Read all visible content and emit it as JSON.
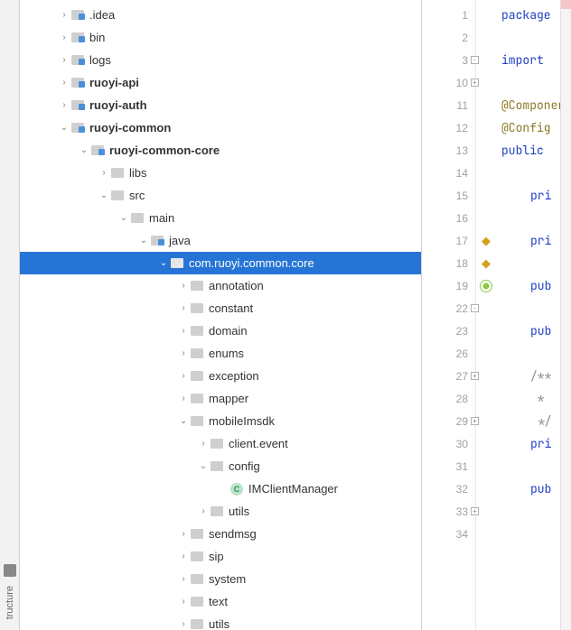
{
  "toolwindow": {
    "structure_label": "tructure"
  },
  "tree": [
    {
      "depth": 0,
      "expand": ">",
      "icon": "folder-marked",
      "label": ".idea"
    },
    {
      "depth": 0,
      "expand": ">",
      "icon": "folder-marked",
      "label": "bin"
    },
    {
      "depth": 0,
      "expand": ">",
      "icon": "folder-marked",
      "label": "logs"
    },
    {
      "depth": 0,
      "expand": ">",
      "icon": "folder-marked",
      "label": "ruoyi-api",
      "bold": true
    },
    {
      "depth": 0,
      "expand": ">",
      "icon": "folder-marked",
      "label": "ruoyi-auth",
      "bold": true
    },
    {
      "depth": 0,
      "expand": "v",
      "icon": "folder-marked",
      "label": "ruoyi-common",
      "bold": true
    },
    {
      "depth": 1,
      "expand": "v",
      "icon": "folder-marked",
      "label": "ruoyi-common-core",
      "bold": true
    },
    {
      "depth": 2,
      "expand": ">",
      "icon": "folder-plain",
      "label": "libs"
    },
    {
      "depth": 2,
      "expand": "v",
      "icon": "folder-plain",
      "label": "src"
    },
    {
      "depth": 3,
      "expand": "v",
      "icon": "folder-plain",
      "label": "main"
    },
    {
      "depth": 4,
      "expand": "v",
      "icon": "folder-marked",
      "label": "java"
    },
    {
      "depth": 5,
      "expand": "v",
      "icon": "folder-plain",
      "label": "com.ruoyi.common.core",
      "selected": true
    },
    {
      "depth": 6,
      "expand": ">",
      "icon": "folder-plain",
      "label": "annotation"
    },
    {
      "depth": 6,
      "expand": ">",
      "icon": "folder-plain",
      "label": "constant"
    },
    {
      "depth": 6,
      "expand": ">",
      "icon": "folder-plain",
      "label": "domain"
    },
    {
      "depth": 6,
      "expand": ">",
      "icon": "folder-plain",
      "label": "enums"
    },
    {
      "depth": 6,
      "expand": ">",
      "icon": "folder-plain",
      "label": "exception"
    },
    {
      "depth": 6,
      "expand": ">",
      "icon": "folder-plain",
      "label": "mapper"
    },
    {
      "depth": 6,
      "expand": "v",
      "icon": "folder-plain",
      "label": "mobileImsdk"
    },
    {
      "depth": 7,
      "expand": ">",
      "icon": "folder-plain",
      "label": "client.event"
    },
    {
      "depth": 7,
      "expand": "v",
      "icon": "folder-plain",
      "label": "config"
    },
    {
      "depth": 8,
      "expand": "",
      "icon": "class",
      "label": "IMClientManager"
    },
    {
      "depth": 7,
      "expand": ">",
      "icon": "folder-plain",
      "label": "utils"
    },
    {
      "depth": 6,
      "expand": ">",
      "icon": "folder-plain",
      "label": "sendmsg"
    },
    {
      "depth": 6,
      "expand": ">",
      "icon": "folder-plain",
      "label": "sip"
    },
    {
      "depth": 6,
      "expand": ">",
      "icon": "folder-plain",
      "label": "system"
    },
    {
      "depth": 6,
      "expand": ">",
      "icon": "folder-plain",
      "label": "text"
    },
    {
      "depth": 6,
      "expand": ">",
      "icon": "folder-plain",
      "label": "utils"
    }
  ],
  "gutter": {
    "lines": [
      "1",
      "2",
      "3",
      "10",
      "11",
      "12",
      "13",
      "14",
      "15",
      "16",
      "17",
      "18",
      "19",
      "22",
      "23",
      "26",
      "27",
      "28",
      "29",
      "30",
      "31",
      "32",
      "33",
      "34"
    ],
    "folds": {
      "2": "-",
      "3": "+",
      "13": "-",
      "16": "+",
      "18": "+",
      "22": "+",
      "26": "+",
      "31": "-"
    },
    "marks": {
      "10": "y",
      "11": "y",
      "12": "spring"
    }
  },
  "code": {
    "lines": [
      {
        "ln": "1",
        "cls": "",
        "html": "<span class='kw'>package</span>"
      },
      {
        "ln": "2",
        "cls": "",
        "html": ""
      },
      {
        "ln": "3",
        "cls": "",
        "html": "<span class='kw'>import</span> "
      },
      {
        "ln": "10",
        "cls": "",
        "html": ""
      },
      {
        "ln": "11",
        "cls": "",
        "html": "<span class='ann'>@Componer</span>"
      },
      {
        "ln": "12",
        "cls": "",
        "html": "<span class='ann'>@Config</span>"
      },
      {
        "ln": "13",
        "cls": "",
        "html": "<span class='kw'>public</span> "
      },
      {
        "ln": "14",
        "cls": "",
        "html": ""
      },
      {
        "ln": "15",
        "cls": "indent1",
        "html": "<span class='kw'>pri</span>"
      },
      {
        "ln": "16",
        "cls": "",
        "html": ""
      },
      {
        "ln": "17",
        "cls": "indent1",
        "html": "<span class='kw'>pri</span>"
      },
      {
        "ln": "18",
        "cls": "",
        "html": ""
      },
      {
        "ln": "19",
        "cls": "indent1",
        "html": "<span class='kw'>pub</span>"
      },
      {
        "ln": "22",
        "cls": "",
        "html": ""
      },
      {
        "ln": "23",
        "cls": "indent1",
        "html": "<span class='kw'>pub</span>"
      },
      {
        "ln": "26",
        "cls": "",
        "html": ""
      },
      {
        "ln": "27",
        "cls": "indent1",
        "html": "<span class='cmt'>/**</span>"
      },
      {
        "ln": "28",
        "cls": "indent1",
        "html": "<span class='cmt'> * </span>"
      },
      {
        "ln": "29",
        "cls": "indent1",
        "html": "<span class='cmt'> */</span>"
      },
      {
        "ln": "30",
        "cls": "indent1",
        "html": "<span class='kw'>pri</span>"
      },
      {
        "ln": "31",
        "cls": "",
        "html": ""
      },
      {
        "ln": "32",
        "cls": "indent1",
        "html": "<span class='kw'>pub</span>"
      },
      {
        "ln": "33",
        "cls": "",
        "html": ""
      },
      {
        "ln": "34",
        "cls": "",
        "html": ""
      }
    ]
  }
}
